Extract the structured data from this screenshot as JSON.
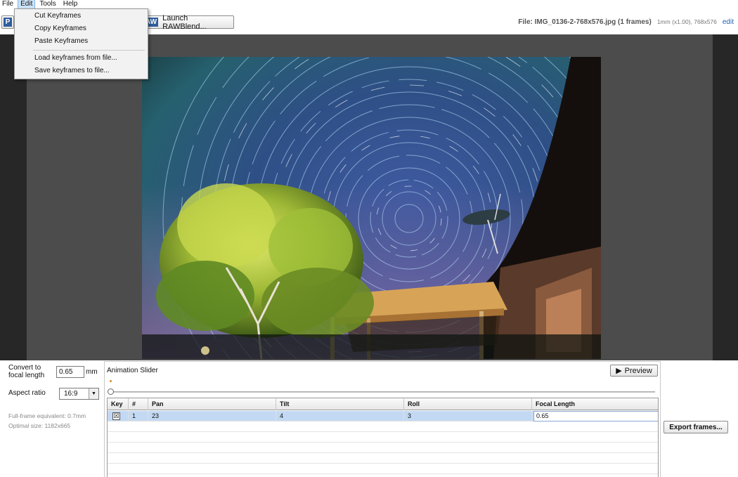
{
  "menu": {
    "items": [
      "File",
      "Edit",
      "Tools",
      "Help"
    ],
    "active": "Edit"
  },
  "toolbar": {
    "left_stub_icon": "P",
    "raw_icon": "AW",
    "raw_button": "Launch RAWBlend...",
    "file_name": "File: IMG_0136-2-768x576.jpg (1 frames)",
    "file_meta": "1mm (x1.00), 768x576",
    "edit_link": "edit"
  },
  "dropdown": {
    "items": [
      "Cut Keyframes",
      "Copy Keyframes",
      "Paste Keyframes",
      "Load keyframes from file...",
      "Save keyframes to file..."
    ]
  },
  "settings": {
    "convert_label": "Convert to\nfocal length",
    "focal_value": "0.65",
    "focal_unit": "mm",
    "aspect_label": "Aspect ratio",
    "aspect_value": "16:9",
    "fullframe_note": "Full-frame equivalent: 0.7mm",
    "optimal_note": "Optimal size: 1182x665"
  },
  "animation": {
    "title": "Animation Slider",
    "preview_label": "Preview",
    "columns": [
      "Key",
      "#",
      "Pan",
      "Tilt",
      "Roll",
      "Focal Length"
    ],
    "rows": [
      {
        "key": "☒",
        "num": "1",
        "pan": "23",
        "tilt": "4",
        "roll": "3",
        "focal": "0.65"
      }
    ]
  },
  "export_label": "Export frames...",
  "colors": {
    "menu_highlight": "#cde4f7",
    "row_selected": "#c3d9f3",
    "viewport_bg": "#272727",
    "canvas_bg": "#4c4c4c",
    "link": "#2060b0"
  }
}
